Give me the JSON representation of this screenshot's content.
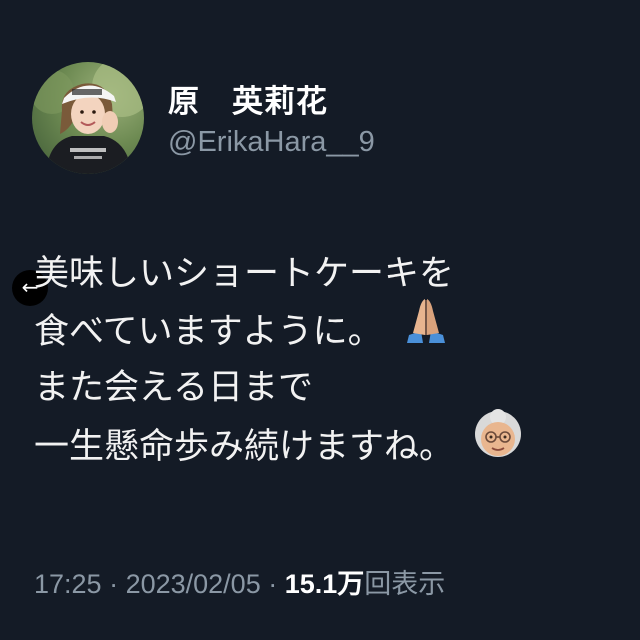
{
  "author": {
    "display_name": "原　英莉花",
    "handle": "@ErikaHara__9",
    "avatar_icon": "profile-photo-icon"
  },
  "tweet": {
    "lines": [
      "美味しいショートケーキを",
      "食べていますように。",
      "また会える日まで",
      "一生懸命歩み続けますね。"
    ],
    "emojis": [
      "folded-hands-icon",
      "old-woman-icon"
    ]
  },
  "meta": {
    "time": "17:25",
    "sep1": " · ",
    "date": "2023/02/05",
    "sep2": " · ",
    "views_count": "15.1万",
    "views_label": "回表示"
  },
  "nav": {
    "back_icon": "arrow-left-icon"
  },
  "colors": {
    "background": "#141b26",
    "secondary_text": "#8b98a5",
    "primary_text": "#ffffff"
  }
}
